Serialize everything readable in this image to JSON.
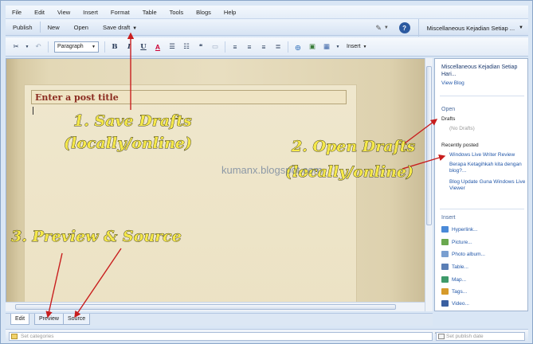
{
  "menubar": {
    "items": [
      "File",
      "Edit",
      "View",
      "Insert",
      "Format",
      "Table",
      "Tools",
      "Blogs",
      "Help"
    ]
  },
  "cmdbar": {
    "publish": "Publish",
    "new": "New",
    "open": "Open",
    "save_draft": "Save draft",
    "blog_name": "Miscellaneous Kejadian Setiap ..."
  },
  "formatbar": {
    "paragraph": "Paragraph",
    "insert": "Insert"
  },
  "editor": {
    "title_placeholder": "Enter a post title"
  },
  "sidebar": {
    "blog_name": "Miscellaneous Kejadian Setiap Hari...",
    "view_blog": "View Blog",
    "open_heading": "Open",
    "drafts_label": "Drafts",
    "no_drafts": "(No Drafts)",
    "recent_heading": "Recently posted",
    "recent_posts": [
      "Windows Live Writer Review",
      "Berapa Ketagihkah kita dengan blog?...",
      "Blog Update Guna Windows Live Viewer"
    ],
    "insert_heading": "Insert",
    "insert_items": [
      {
        "label": "Hyperlink...",
        "icon": "hyperlink-icon",
        "color": "#4a8ad8"
      },
      {
        "label": "Picture...",
        "icon": "picture-icon",
        "color": "#6aa84f"
      },
      {
        "label": "Photo album...",
        "icon": "photo-album-icon",
        "color": "#7a9fd0"
      },
      {
        "label": "Table...",
        "icon": "table-icon",
        "color": "#5b7fb5"
      },
      {
        "label": "Map...",
        "icon": "map-icon",
        "color": "#3e9a6a"
      },
      {
        "label": "Tags...",
        "icon": "tags-icon",
        "color": "#d69a2a"
      },
      {
        "label": "Video...",
        "icon": "video-icon",
        "color": "#3a5fa0"
      }
    ]
  },
  "viewtabs": {
    "edit": "Edit",
    "preview": "Preview",
    "source": "Source"
  },
  "propbar": {
    "categories_placeholder": "Set categories",
    "date_placeholder": "Set publish date"
  },
  "annotations": {
    "save_drafts_1": "1. Save Drafts",
    "save_drafts_2": "(locally/online)",
    "open_drafts_1": "2. Open Drafts",
    "open_drafts_2": "(locally/online)",
    "preview_source": "3. Preview & Source",
    "watermark": "kumanx.blogspot.com"
  }
}
